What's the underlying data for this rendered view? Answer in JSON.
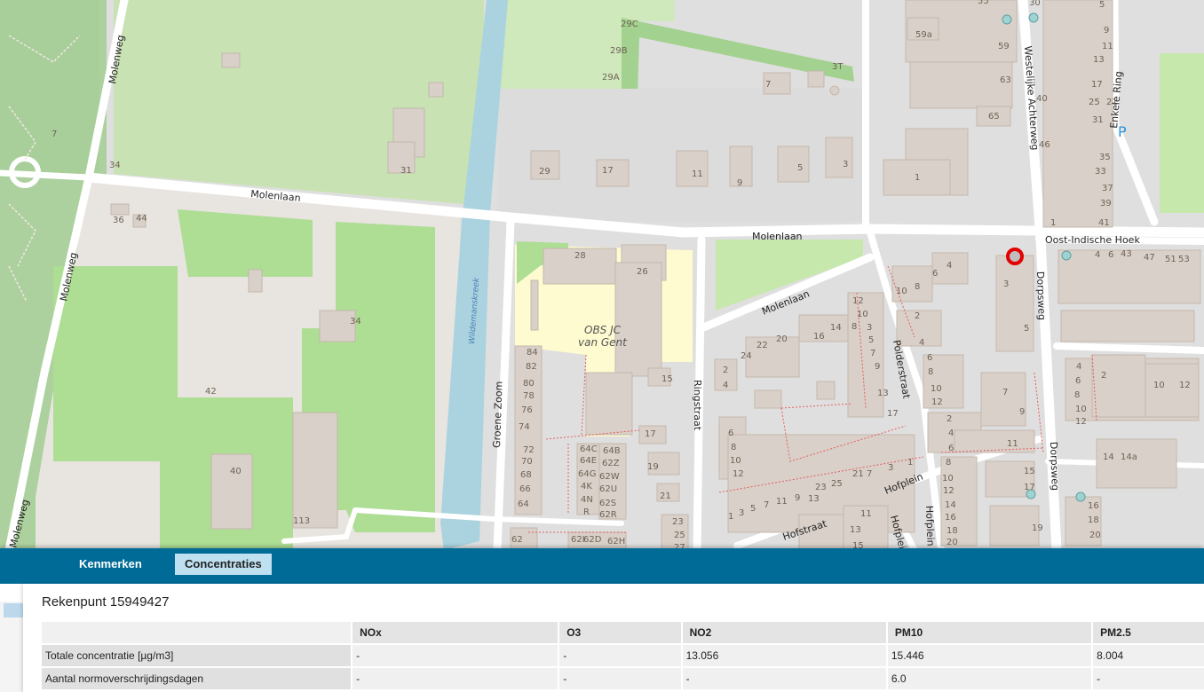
{
  "map": {
    "streets": {
      "molenweg_top": "Molenweg",
      "molenweg_mid": "Molenweg",
      "molenweg_bottom": "Molenweg",
      "molenlaan_west": "Molenlaan",
      "molenlaan_east": "Molenlaan",
      "molenlaan_south": "Molenlaan",
      "groene_zoom": "Groene Zoom",
      "ringstraat": "Ringstraat",
      "polderstraat": "Polderstraat",
      "westelijke": "Westelijke Achterweg",
      "enkele_ring": "Enkele Ring",
      "oost_indische": "Oost-Indische Hoek",
      "dorpsweg_north": "Dorpsweg",
      "dorpsweg_south": "Dorpsweg",
      "hofplein_a": "Hofplein",
      "hofplein_b": "Hofplein",
      "hofplein_c": "Hofplein",
      "hofstraat": "Hofstraat",
      "wildemanskreek": "Wildemanskreek"
    },
    "school_line1": "OBS JC",
    "school_line2": "van Gent",
    "parking": "P",
    "house_numbers": {
      "n55": "55",
      "n30": "30",
      "n59a": "59a",
      "n59": "59",
      "n63": "63",
      "n65": "65",
      "n1a": "1",
      "n29c": "29C",
      "n29b": "29B",
      "n29a": "29A",
      "n3t": "3T",
      "n7a": "7",
      "n29": "29",
      "n17a": "17",
      "n11a": "11",
      "n9a": "9",
      "n5a": "5",
      "n3a": "3",
      "n7b": "7",
      "n34a": "34",
      "n31": "31",
      "n36": "36",
      "n44": "44",
      "n34b": "34",
      "n42": "42",
      "n40": "40",
      "n113": "113",
      "n28": "28",
      "n26": "26",
      "n84": "84",
      "n82": "82",
      "n80": "80",
      "n78": "78",
      "n76": "76",
      "n74": "74",
      "n72": "72",
      "n70": "70",
      "n68": "68",
      "n66": "66",
      "n64": "64",
      "n64c": "64C",
      "n64e": "64E",
      "n64g": "64G",
      "n64k": "4K",
      "n64n": "4N",
      "n64r": "R",
      "n64b": "64B",
      "n62z": "62Z",
      "n62w": "62W",
      "n62u": "62U",
      "n62s": "62S",
      "n62r": "62R",
      "n15a": "15",
      "n17b": "17",
      "n19a": "19",
      "n21a": "21",
      "n23a": "23",
      "n25a": "25",
      "n27a": "27",
      "n62": "62",
      "n62i": "62I",
      "n62d": "62D",
      "n62h": "62H",
      "n46": "46",
      "n40b": "40",
      "n25": "25",
      "n21": "21",
      "n13": "13",
      "n17": "17",
      "n31b": "31",
      "n33": "33",
      "n35": "35",
      "n37": "37",
      "n39": "39",
      "n41": "41",
      "n1b": "1",
      "n5b": "5",
      "n9b": "9",
      "n11b": "11",
      "n4": "4",
      "n6": "6",
      "n43": "43",
      "n47": "47",
      "n51": "51",
      "n53": "53",
      "n10a": "10",
      "n8a": "8",
      "n6a": "6",
      "n4a": "4",
      "n3b": "3",
      "n5c": "5",
      "n12a": "12",
      "n10b": "10",
      "n8b": "8",
      "n6b": "6",
      "n4b": "4",
      "n2a": "2",
      "n20": "20",
      "n16": "16",
      "n14": "14",
      "n24": "24",
      "n22": "22",
      "n2b": "2",
      "n4c": "4",
      "n1c": "1",
      "n3c": "3",
      "n5d": "5",
      "n7c": "7",
      "n9c": "9",
      "n11c": "11",
      "n13b": "13",
      "n15b": "15",
      "n17c": "17",
      "n6c": "6",
      "n8c": "8",
      "n10c": "10",
      "n12b": "12",
      "n2c": "2",
      "n4d": "4",
      "n6d": "6",
      "n8d": "8",
      "n10d": "10",
      "n12c": "12",
      "n7d": "7",
      "n9d": "9",
      "n11d": "11",
      "n2d": "2",
      "n4e": "4",
      "n6e": "6",
      "n8e": "8",
      "n10e": "10",
      "n12d": "12",
      "n14b": "14",
      "n16b": "16",
      "n18b": "18",
      "n20b": "20",
      "n15c": "15",
      "n17d": "17",
      "n19b": "19",
      "n1d": "1",
      "n3d": "3",
      "n5e": "5",
      "n7e": "7",
      "n9e": "9",
      "n11e": "11",
      "n13c": "13",
      "n15d": "15",
      "n17e": "17",
      "n19c": "19",
      "n21b": "21",
      "n23b": "23",
      "n25b": "25",
      "n27b": "27",
      "n29b2": "29",
      "n31c": "31",
      "n4f": "4",
      "n6f": "6",
      "n8f": "8",
      "n10f": "10",
      "n12e": "12",
      "n2e": "2",
      "n10g": "10",
      "n12f": "12",
      "n14c": "14",
      "n14a": "14a",
      "n16c": "16",
      "n18c": "18",
      "n20c": "20",
      "n1e": "1",
      "n3e": "3",
      "n5f": "5",
      "n7f": "7",
      "n9f": "9",
      "n11f": "11",
      "n13d": "13",
      "n15e": "15"
    }
  },
  "tabs": [
    {
      "label": "Kenmerken"
    },
    {
      "label": "Concentraties"
    }
  ],
  "panel": {
    "title": "Rekenpunt 15949427",
    "columns": [
      "",
      "NOx",
      "O3",
      "NO2",
      "PM10",
      "PM2.5"
    ],
    "rows": [
      {
        "label": "Totale concentratie [µg/m3]",
        "values": [
          "-",
          "-",
          "13.056",
          "15.446",
          "8.004"
        ]
      },
      {
        "label": "Aantal normoverschrijdingsdagen",
        "values": [
          "-",
          "-",
          "-",
          "6.0",
          "-"
        ]
      }
    ]
  },
  "colors": {
    "tabbar": "#006b96",
    "active_tab": "#bfe0f0",
    "marker": "#e30000"
  }
}
